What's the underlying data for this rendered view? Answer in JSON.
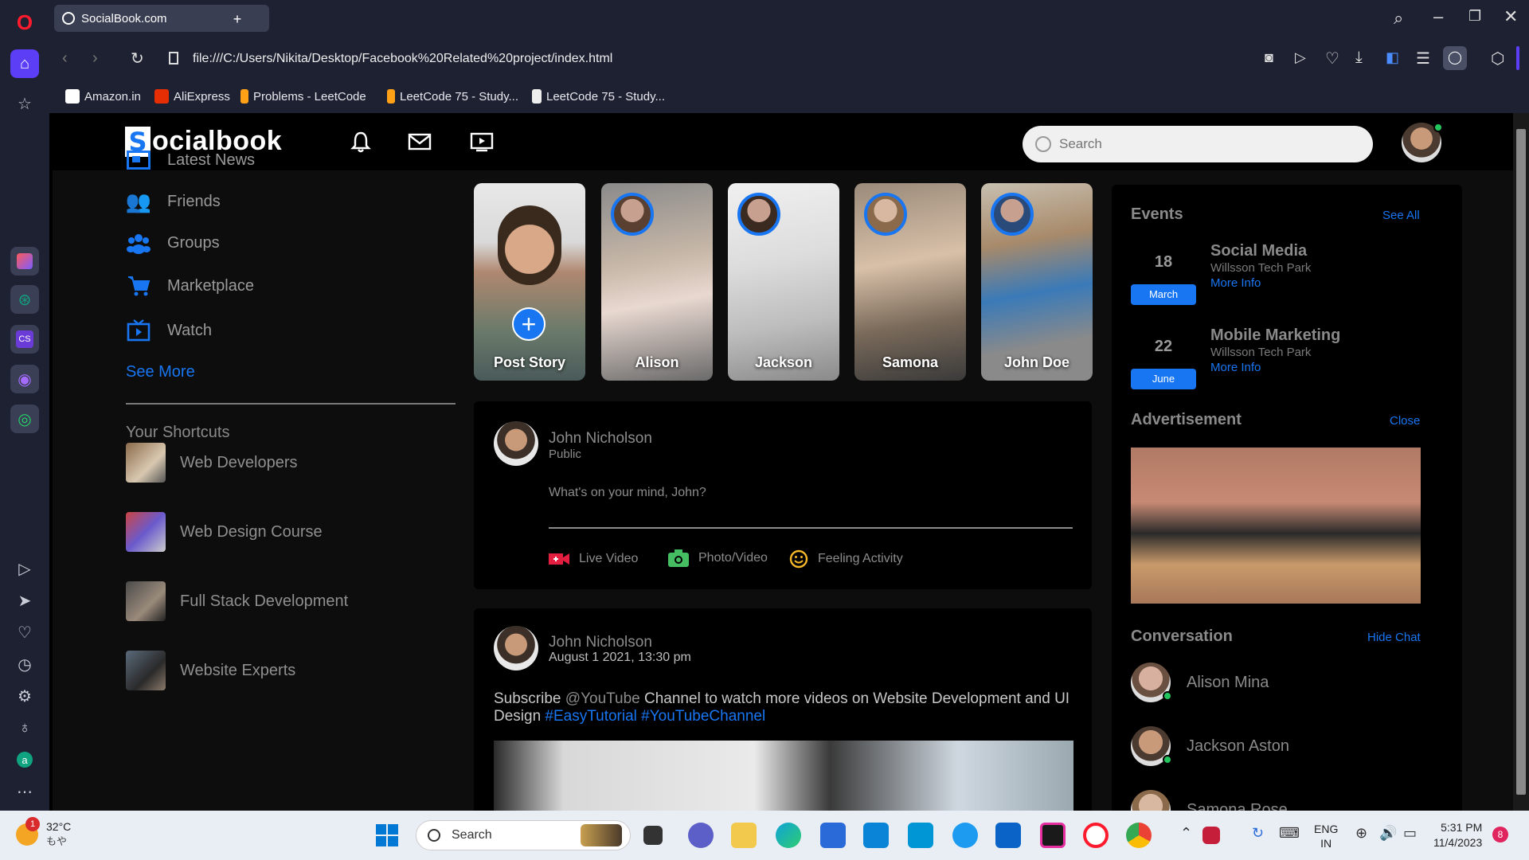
{
  "browser": {
    "tab_title": "SocialBook.com",
    "url": "file:///C:/Users/Nikita/Desktop/Facebook%20Related%20project/index.html",
    "bookmarks": [
      "Amazon.in",
      "AliExpress",
      "Problems - LeetCode",
      "LeetCode 75 - Study...",
      "LeetCode 75 - Study..."
    ]
  },
  "nav": {
    "logo_letter": "S",
    "logo_text": "ocialbook",
    "search_placeholder": "Search"
  },
  "left_sidebar": {
    "items": [
      "Latest News",
      "Friends",
      "Groups",
      "Marketplace",
      "Watch"
    ],
    "see_more": "See More",
    "shortcuts_title": "Your Shortcuts",
    "shortcuts": [
      "Web Developers",
      "Web Design Course",
      "Full Stack Development",
      "Website Experts"
    ]
  },
  "stories": [
    "Post Story",
    "Alison",
    "Jackson",
    "Samona",
    "John Doe"
  ],
  "composer": {
    "name": "John Nicholson",
    "visibility": "Public",
    "placeholder": "What's on your mind, John?",
    "actions": [
      "Live Video",
      "Photo/Video",
      "Feeling Activity"
    ]
  },
  "post": {
    "name": "John Nicholson",
    "time": "August 1 2021, 13:30 pm",
    "text_pre": "Subscribe ",
    "mention": "@YouTube",
    "text_mid": " Channel to watch more videos on Website Development and UI Design ",
    "tag1": "#EasyTutorial",
    "tag2": "#YouTubeChannel"
  },
  "right": {
    "events_title": "Events",
    "see_all": "See All",
    "events": [
      {
        "day": "18",
        "month": "March",
        "title": "Social Media",
        "location": "Willsson Tech Park",
        "link": "More Info"
      },
      {
        "day": "22",
        "month": "June",
        "title": "Mobile Marketing",
        "location": "Willsson Tech Park",
        "link": "More Info"
      }
    ],
    "ad_title": "Advertisement",
    "ad_close": "Close",
    "conv_title": "Conversation",
    "hide_chat": "Hide Chat",
    "contacts": [
      "Alison Mina",
      "Jackson Aston",
      "Samona Rose"
    ]
  },
  "taskbar": {
    "weather_temp": "32°C",
    "weather_sub": "もや",
    "weather_badge": "1",
    "search": "Search",
    "lang1": "ENG",
    "lang2": "IN",
    "time": "5:31 PM",
    "date": "11/4/2023",
    "notif": "8"
  }
}
